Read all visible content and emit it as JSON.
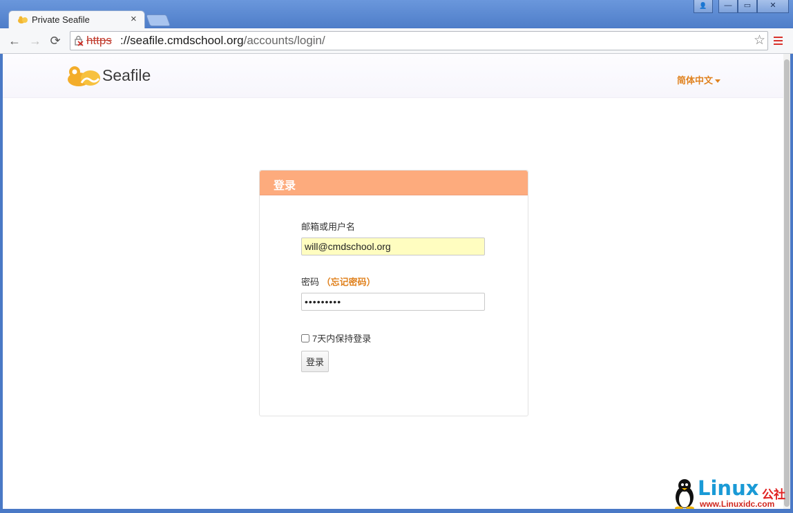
{
  "browser": {
    "tab_title": "Private Seafile",
    "tab_close": "×",
    "url_scheme": "https",
    "url_host": "://seafile.cmdschool.org",
    "url_path": "/accounts/login/",
    "back": "←",
    "forward": "→",
    "reload": "⟳",
    "star": "☆",
    "win_buttons": [
      "👤",
      "—",
      "▭",
      "✕"
    ]
  },
  "header": {
    "logo_text": "Seafile",
    "language": "简体中文"
  },
  "login": {
    "title": "登录",
    "username_label": "邮箱或用户名",
    "username_value": "will@cmdschool.org",
    "password_label": "密码",
    "forgot_label": "（忘记密码）",
    "password_mask": "•••••••••",
    "remember_label": "7天内保持登录",
    "submit_label": "登录"
  },
  "watermark": {
    "brand": "Linux",
    "brand_cn": "公社",
    "url": "www.Linuxidc.com"
  },
  "colors": {
    "accent": "#e0821f",
    "card_header": "#fdab7d",
    "autofill": "#fffdc0"
  }
}
